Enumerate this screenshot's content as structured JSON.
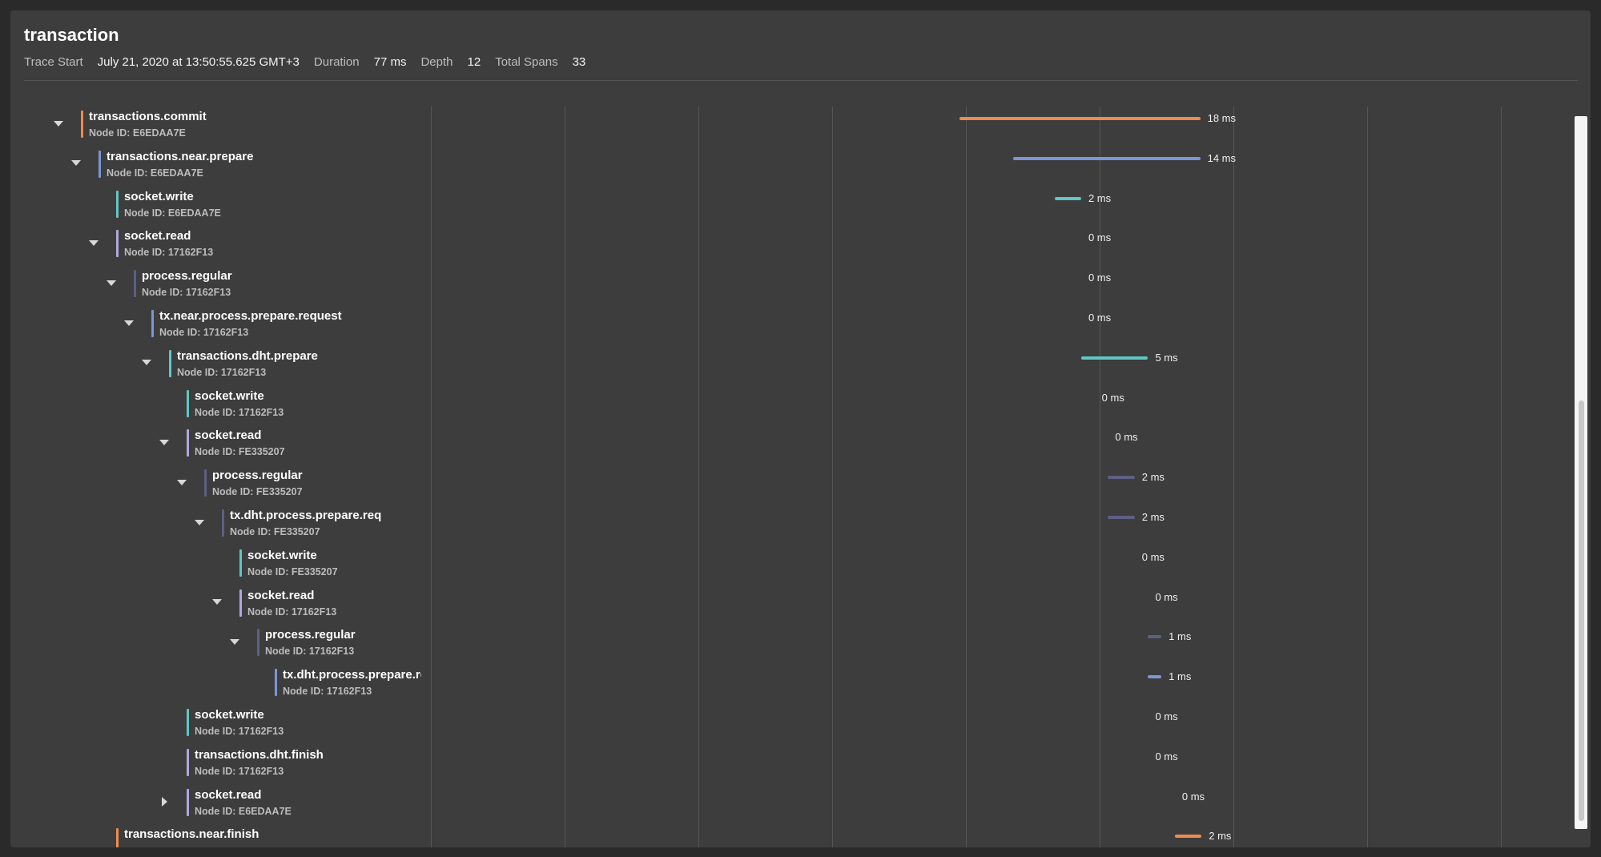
{
  "header": {
    "title": "transaction",
    "trace_start_label": "Trace Start",
    "trace_start_value": "July 21, 2020 at 13:50:55.625 GMT+3",
    "duration_label": "Duration",
    "duration_value": "77 ms",
    "depth_label": "Depth",
    "depth_value": "12",
    "total_spans_label": "Total Spans",
    "total_spans_value": "33"
  },
  "colors": {
    "orange": "#ef8b4f",
    "blue": "#7c96d6",
    "teal": "#5fc7c4",
    "lavender": "#b0a8e0",
    "slate": "#5d5f84"
  },
  "spans": [
    {
      "name": "transactions.commit",
      "node": "Node ID: E6EDAA7E",
      "depth": 0,
      "toggle": "expanded",
      "color": "orange",
      "start_ms": 58.5,
      "duration_ms": 18,
      "duration": "18 ms"
    },
    {
      "name": "transactions.near.prepare",
      "node": "Node ID: E6EDAA7E",
      "depth": 1,
      "toggle": "expanded",
      "color": "blue",
      "start_ms": 62.5,
      "duration_ms": 14,
      "duration": "14 ms"
    },
    {
      "name": "socket.write",
      "node": "Node ID: E6EDAA7E",
      "depth": 2,
      "toggle": "none",
      "color": "teal",
      "start_ms": 65.6,
      "duration_ms": 2,
      "duration": "2 ms"
    },
    {
      "name": "socket.read",
      "node": "Node ID: 17162F13",
      "depth": 2,
      "toggle": "expanded",
      "color": "lavender",
      "start_ms": 67.6,
      "duration_ms": 0,
      "duration": "0 ms"
    },
    {
      "name": "process.regular",
      "node": "Node ID: 17162F13",
      "depth": 3,
      "toggle": "expanded",
      "color": "slate",
      "start_ms": 67.6,
      "duration_ms": 0,
      "duration": "0 ms"
    },
    {
      "name": "tx.near.process.prepare.request",
      "node": "Node ID: 17162F13",
      "depth": 4,
      "toggle": "expanded",
      "color": "blue",
      "start_ms": 67.6,
      "duration_ms": 0,
      "duration": "0 ms"
    },
    {
      "name": "transactions.dht.prepare",
      "node": "Node ID: 17162F13",
      "depth": 5,
      "toggle": "expanded",
      "color": "teal",
      "start_ms": 67.6,
      "duration_ms": 5,
      "duration": "5 ms"
    },
    {
      "name": "socket.write",
      "node": "Node ID: 17162F13",
      "depth": 6,
      "toggle": "none",
      "color": "teal",
      "start_ms": 68.6,
      "duration_ms": 0,
      "duration": "0 ms"
    },
    {
      "name": "socket.read",
      "node": "Node ID: FE335207",
      "depth": 6,
      "toggle": "expanded",
      "color": "lavender",
      "start_ms": 69.6,
      "duration_ms": 0,
      "duration": "0 ms"
    },
    {
      "name": "process.regular",
      "node": "Node ID: FE335207",
      "depth": 7,
      "toggle": "expanded",
      "color": "slate",
      "start_ms": 69.6,
      "duration_ms": 2,
      "duration": "2 ms"
    },
    {
      "name": "tx.dht.process.prepare.req",
      "node": "Node ID: FE335207",
      "depth": 8,
      "toggle": "expanded",
      "color": "slate",
      "start_ms": 69.6,
      "duration_ms": 2,
      "duration": "2 ms"
    },
    {
      "name": "socket.write",
      "node": "Node ID: FE335207",
      "depth": 9,
      "toggle": "none",
      "color": "teal",
      "start_ms": 71.6,
      "duration_ms": 0,
      "duration": "0 ms"
    },
    {
      "name": "socket.read",
      "node": "Node ID: 17162F13",
      "depth": 9,
      "toggle": "expanded",
      "color": "lavender",
      "start_ms": 72.6,
      "duration_ms": 0,
      "duration": "0 ms"
    },
    {
      "name": "process.regular",
      "node": "Node ID: 17162F13",
      "depth": 10,
      "toggle": "expanded",
      "color": "slate",
      "start_ms": 72.6,
      "duration_ms": 1,
      "duration": "1 ms"
    },
    {
      "name": "tx.dht.process.prepare.re",
      "node": "Node ID: 17162F13",
      "depth": 11,
      "toggle": "none",
      "color": "blue",
      "start_ms": 72.6,
      "duration_ms": 1,
      "duration": "1 ms"
    },
    {
      "name": "socket.write",
      "node": "Node ID: 17162F13",
      "depth": 6,
      "toggle": "none",
      "color": "teal",
      "start_ms": 72.6,
      "duration_ms": 0,
      "duration": "0 ms"
    },
    {
      "name": "transactions.dht.finish",
      "node": "Node ID: 17162F13",
      "depth": 6,
      "toggle": "none",
      "color": "lavender",
      "start_ms": 72.6,
      "duration_ms": 0,
      "duration": "0 ms"
    },
    {
      "name": "socket.read",
      "node": "Node ID: E6EDAA7E",
      "depth": 6,
      "toggle": "collapsed",
      "color": "lavender",
      "start_ms": 74.6,
      "duration_ms": 0,
      "duration": "0 ms"
    },
    {
      "name": "transactions.near.finish",
      "node": "",
      "depth": 2,
      "toggle": "none",
      "color": "orange",
      "start_ms": 74.6,
      "duration_ms": 2,
      "duration": "2 ms"
    }
  ]
}
